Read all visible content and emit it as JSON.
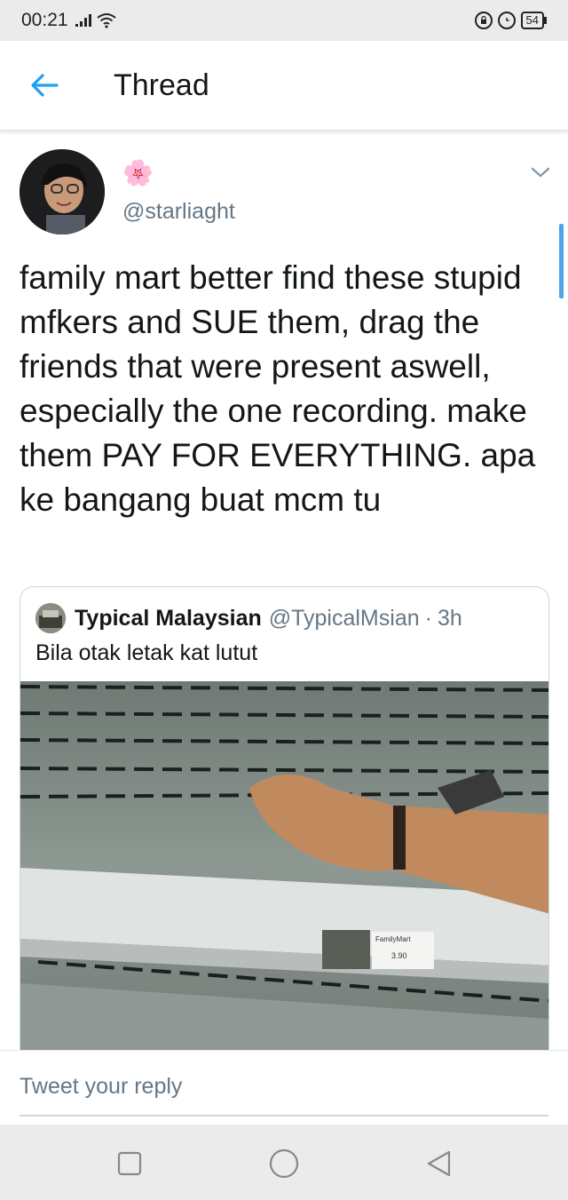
{
  "status_bar": {
    "time": "00:21",
    "battery": "54"
  },
  "header": {
    "title": "Thread"
  },
  "tweet": {
    "display_name": "🌸",
    "handle": "@starliaght",
    "text": "family mart better find these stupid mfkers and SUE them, drag the friends that were present aswell, especially the one recording. make them PAY FOR EVERYTHING. apa ke bangang buat mcm tu"
  },
  "quoted_tweet": {
    "name": "Typical Malaysian",
    "handle": "@TypicalMsian",
    "separator": "·",
    "time": "3h",
    "text": "Bila otak letak kat lutut",
    "media_label": "FamilyMart",
    "media_price": "3.90"
  },
  "reply": {
    "placeholder": "Tweet your reply"
  },
  "colors": {
    "accent": "#1da1f2",
    "secondary_text": "#657786",
    "status_bar_bg": "#ebebeb"
  },
  "icons": {
    "back": "arrow-left-icon",
    "caret": "chevron-down-icon",
    "nav_recent": "square-icon",
    "nav_home": "circle-icon",
    "nav_back": "triangle-back-icon"
  }
}
